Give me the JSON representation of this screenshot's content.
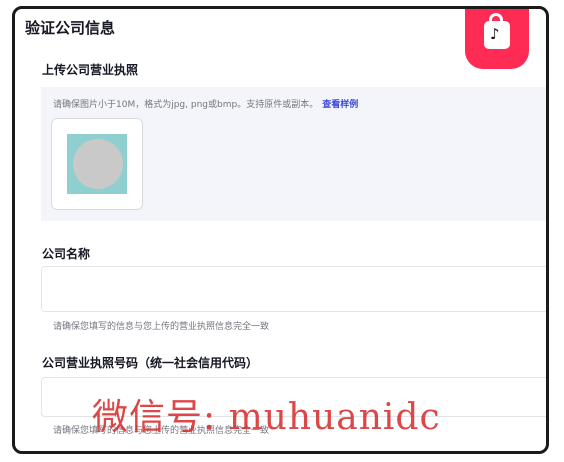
{
  "page": {
    "title": "验证公司信息"
  },
  "logo": {
    "icon": "tiktok-shop-bag-icon",
    "brand_color": "#fe2c55"
  },
  "upload": {
    "label": "上传公司营业执照",
    "hint": "请确保图片小于10M，格式为jpg, png或bmp。支持原件或副本。",
    "example_link": "查看样例"
  },
  "company_name": {
    "label": "公司名称",
    "value": "",
    "helper": "请确保您填写的信息与您上传的营业执照信息完全一致"
  },
  "license_number": {
    "label": "公司营业执照号码（统一社会信用代码）",
    "value": "",
    "helper": "请确保您填写的信息与您上传的营业执照信息完全一致"
  },
  "watermark": "微信号: muhuanidc",
  "colors": {
    "link": "#3b4bd8",
    "upload_bg": "#f4f5fb",
    "watermark": "#d62828"
  }
}
